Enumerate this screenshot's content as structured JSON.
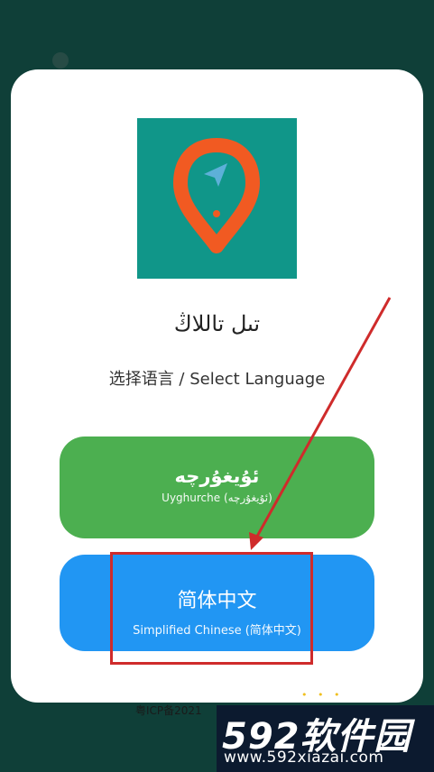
{
  "app": {
    "title": "تىل تاللاڭ",
    "subtitle": "选择语言 / Select Language"
  },
  "buttons": {
    "uyghur": {
      "main": "ئۇيغۇرچە",
      "sub": "Uyghurche (ئۇيغۇرچە)"
    },
    "chinese": {
      "main": "简体中文",
      "sub": "Simplified Chinese (简体中文)"
    }
  },
  "footer": {
    "icp": "粤ICP备2021"
  },
  "watermark": {
    "logo_number": "592",
    "logo_text": "软件园",
    "url": "www.592xiazai.com"
  },
  "colors": {
    "background": "#0f3f38",
    "card": "#ffffff",
    "icon_bg": "#109689",
    "pin": "#f15a22",
    "uyghur_button": "#4caf50",
    "chinese_button": "#2196f3",
    "annotation": "#cf2b2b"
  },
  "icons": {
    "app_icon": "location-pin-icon"
  }
}
